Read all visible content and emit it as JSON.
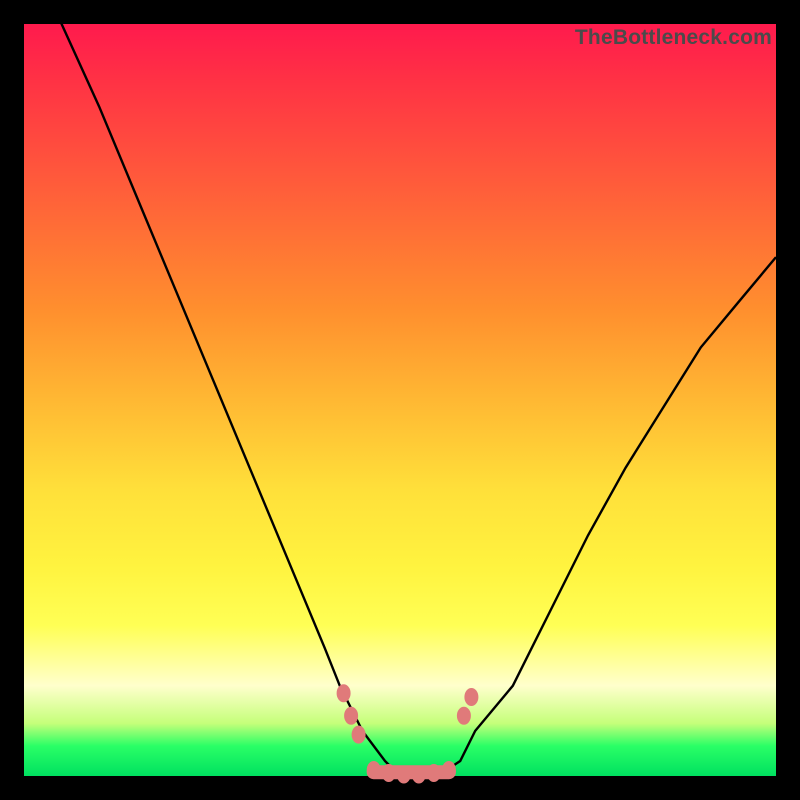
{
  "watermark": "TheBottleneck.com",
  "colors": {
    "background": "#000000",
    "gradient_top": "#ff1a4d",
    "gradient_bottom": "#00e060",
    "curve": "#000000",
    "markers": "#e07a7a"
  },
  "chart_data": {
    "type": "line",
    "title": "",
    "xlabel": "",
    "ylabel": "",
    "xlim": [
      0,
      100
    ],
    "ylim": [
      0,
      100
    ],
    "x": [
      0,
      5,
      10,
      15,
      20,
      25,
      30,
      35,
      40,
      42,
      45,
      48,
      50,
      52,
      55,
      58,
      60,
      65,
      70,
      75,
      80,
      85,
      90,
      95,
      100
    ],
    "values": [
      110,
      100,
      89,
      77,
      65,
      53,
      41,
      29,
      17,
      12,
      6,
      2,
      0,
      0,
      0,
      2,
      6,
      12,
      22,
      32,
      41,
      49,
      57,
      63,
      69
    ],
    "series": [
      {
        "name": "bottleneck-curve",
        "x": [
          0,
          5,
          10,
          15,
          20,
          25,
          30,
          35,
          40,
          42,
          45,
          48,
          50,
          52,
          55,
          58,
          60,
          65,
          70,
          75,
          80,
          85,
          90,
          95,
          100
        ],
        "y": [
          110,
          100,
          89,
          77,
          65,
          53,
          41,
          29,
          17,
          12,
          6,
          2,
          0,
          0,
          0,
          2,
          6,
          12,
          22,
          32,
          41,
          49,
          57,
          63,
          69
        ]
      }
    ],
    "markers": [
      {
        "x": 42.5,
        "y": 11
      },
      {
        "x": 43.5,
        "y": 8
      },
      {
        "x": 44.5,
        "y": 5.5
      },
      {
        "x": 58.5,
        "y": 8
      },
      {
        "x": 59.5,
        "y": 10.5
      },
      {
        "x": 46.5,
        "y": 0.8
      },
      {
        "x": 48.5,
        "y": 0.4
      },
      {
        "x": 50.5,
        "y": 0.2
      },
      {
        "x": 52.5,
        "y": 0.2
      },
      {
        "x": 54.5,
        "y": 0.4
      },
      {
        "x": 56.5,
        "y": 0.8
      }
    ],
    "flat_segment": {
      "x0": 46.5,
      "x1": 56.5,
      "y": 0.5
    }
  }
}
